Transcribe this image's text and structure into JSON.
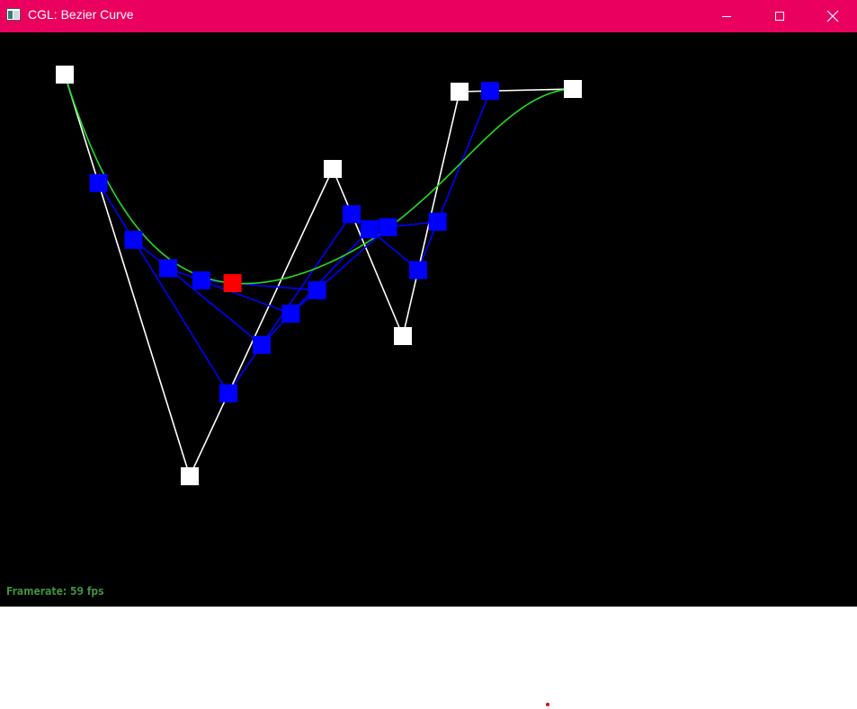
{
  "window": {
    "title": "CGL: Bezier Curve",
    "titlebar_color": "#ea005e",
    "buttons": {
      "minimize_icon": "minimize-icon",
      "maximize_icon": "maximize-icon",
      "close_icon": "close-icon"
    }
  },
  "status": {
    "framerate": "Framerate: 59 fps"
  },
  "scene": {
    "background_color": "#000000",
    "control_polygon_color": "#ffffff",
    "intermediate_color": "#0000ff",
    "curve_color": "#22dd22",
    "current_point_color": "#ff0000",
    "control_point_count": 6
  }
}
